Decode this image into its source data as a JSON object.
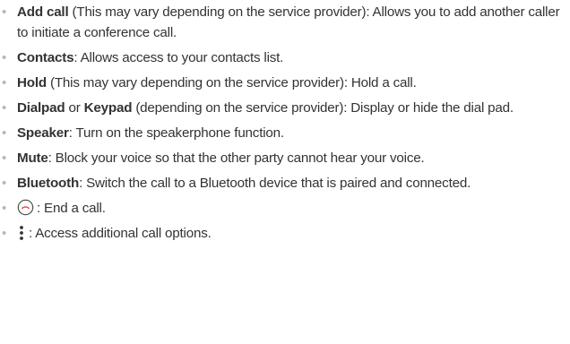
{
  "items": [
    {
      "term": "Add call",
      "description": " (This may vary depending on the service provider): Allows you to add another caller to initiate a conference call."
    },
    {
      "term": "Contacts",
      "description": ": Allows access to your contacts list."
    },
    {
      "term": "Hold",
      "description": " (This may vary depending on the service provider): Hold a call."
    },
    {
      "term": "Dialpad",
      "connector": " or ",
      "term2": "Keypad",
      "description": " (depending on the service provider): Display or hide the dial pad."
    },
    {
      "term": "Speaker",
      "description": ": Turn on the speakerphone function."
    },
    {
      "term": "Mute",
      "description": ": Block your voice so that the other party cannot hear your voice."
    },
    {
      "term": "Bluetooth",
      "description": ": Switch the call to a Bluetooth device that is paired and connected."
    },
    {
      "icon": "end-call-icon",
      "description": ": End a call."
    },
    {
      "icon": "more-options-icon",
      "description": ": Access additional call options."
    }
  ],
  "colors": {
    "text": "#333333",
    "bullet": "#b7b7b7",
    "end_call_icon": "#e5453c"
  }
}
